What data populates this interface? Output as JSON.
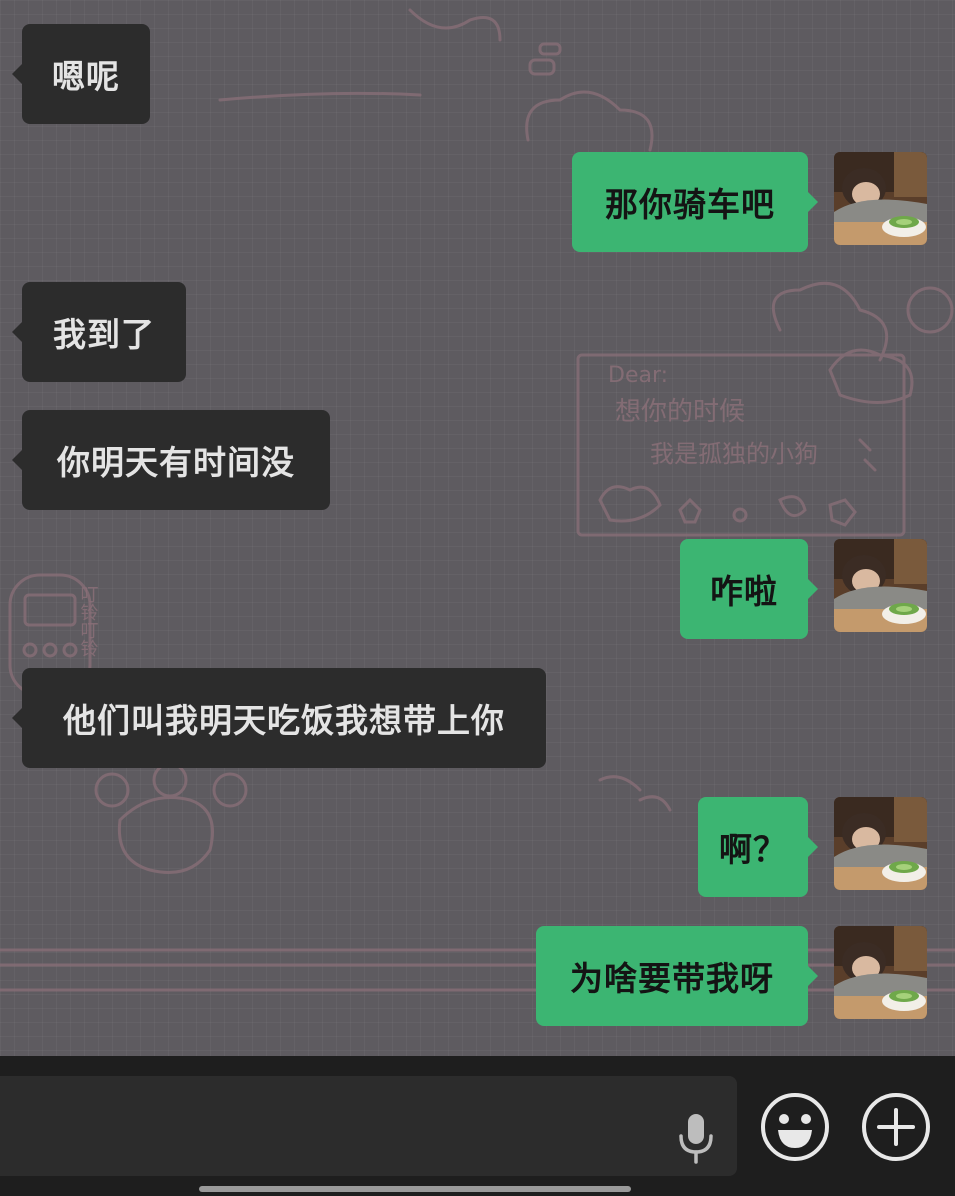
{
  "messages": [
    {
      "side": "in",
      "text": "嗯呢"
    },
    {
      "side": "out",
      "text": "那你骑车吧"
    },
    {
      "side": "in",
      "text": "我到了"
    },
    {
      "side": "in",
      "text": "你明天有时间没"
    },
    {
      "side": "out",
      "text": "咋啦"
    },
    {
      "side": "in",
      "text": "他们叫我明天吃饭我想带上你"
    },
    {
      "side": "out",
      "text": "啊？"
    },
    {
      "side": "out",
      "text": "为啥要带我呀"
    }
  ],
  "wallpaper": {
    "note_greeting": "Dear:",
    "note_line1": "想你的时候",
    "note_line2": "我是孤独的小狗",
    "phone_sticker": "叮铃叮铃"
  },
  "input_bar": {
    "icons": [
      "microphone-icon",
      "emoji-icon",
      "plus-icon"
    ]
  },
  "colors": {
    "incoming_bubble": "#2c2c2c",
    "outgoing_bubble": "#3cb572",
    "background": "#5e5b60",
    "bar": "#1e1e1e"
  }
}
